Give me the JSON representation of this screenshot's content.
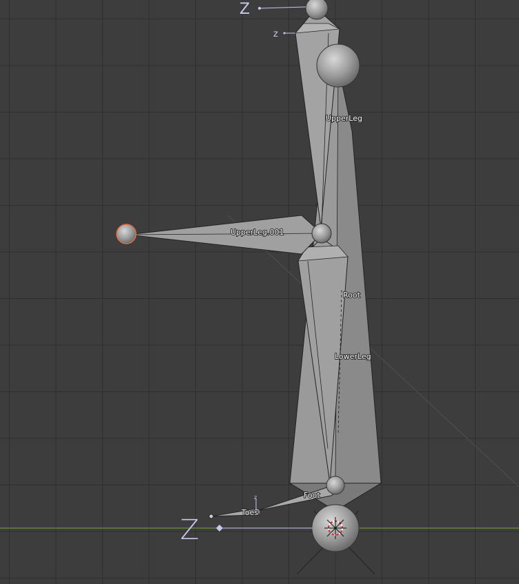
{
  "viewport": {
    "background": "#3d3d3d",
    "grid_color": "#2f2f2f",
    "ground_line_color": "#7fa33a",
    "bone_color": "#9a9a9a",
    "selection_color": "#e07040"
  },
  "bones": {
    "upper_leg": "UpperLeg",
    "upper_leg_001": "UpperLeg.001",
    "root": "Root",
    "lower_leg": "LowerLeg",
    "foot": "Foot",
    "toes": "Toes"
  },
  "axes": {
    "top_large": "Z",
    "top_small": "z",
    "toes_small": "z",
    "bottom_large": "Z"
  }
}
